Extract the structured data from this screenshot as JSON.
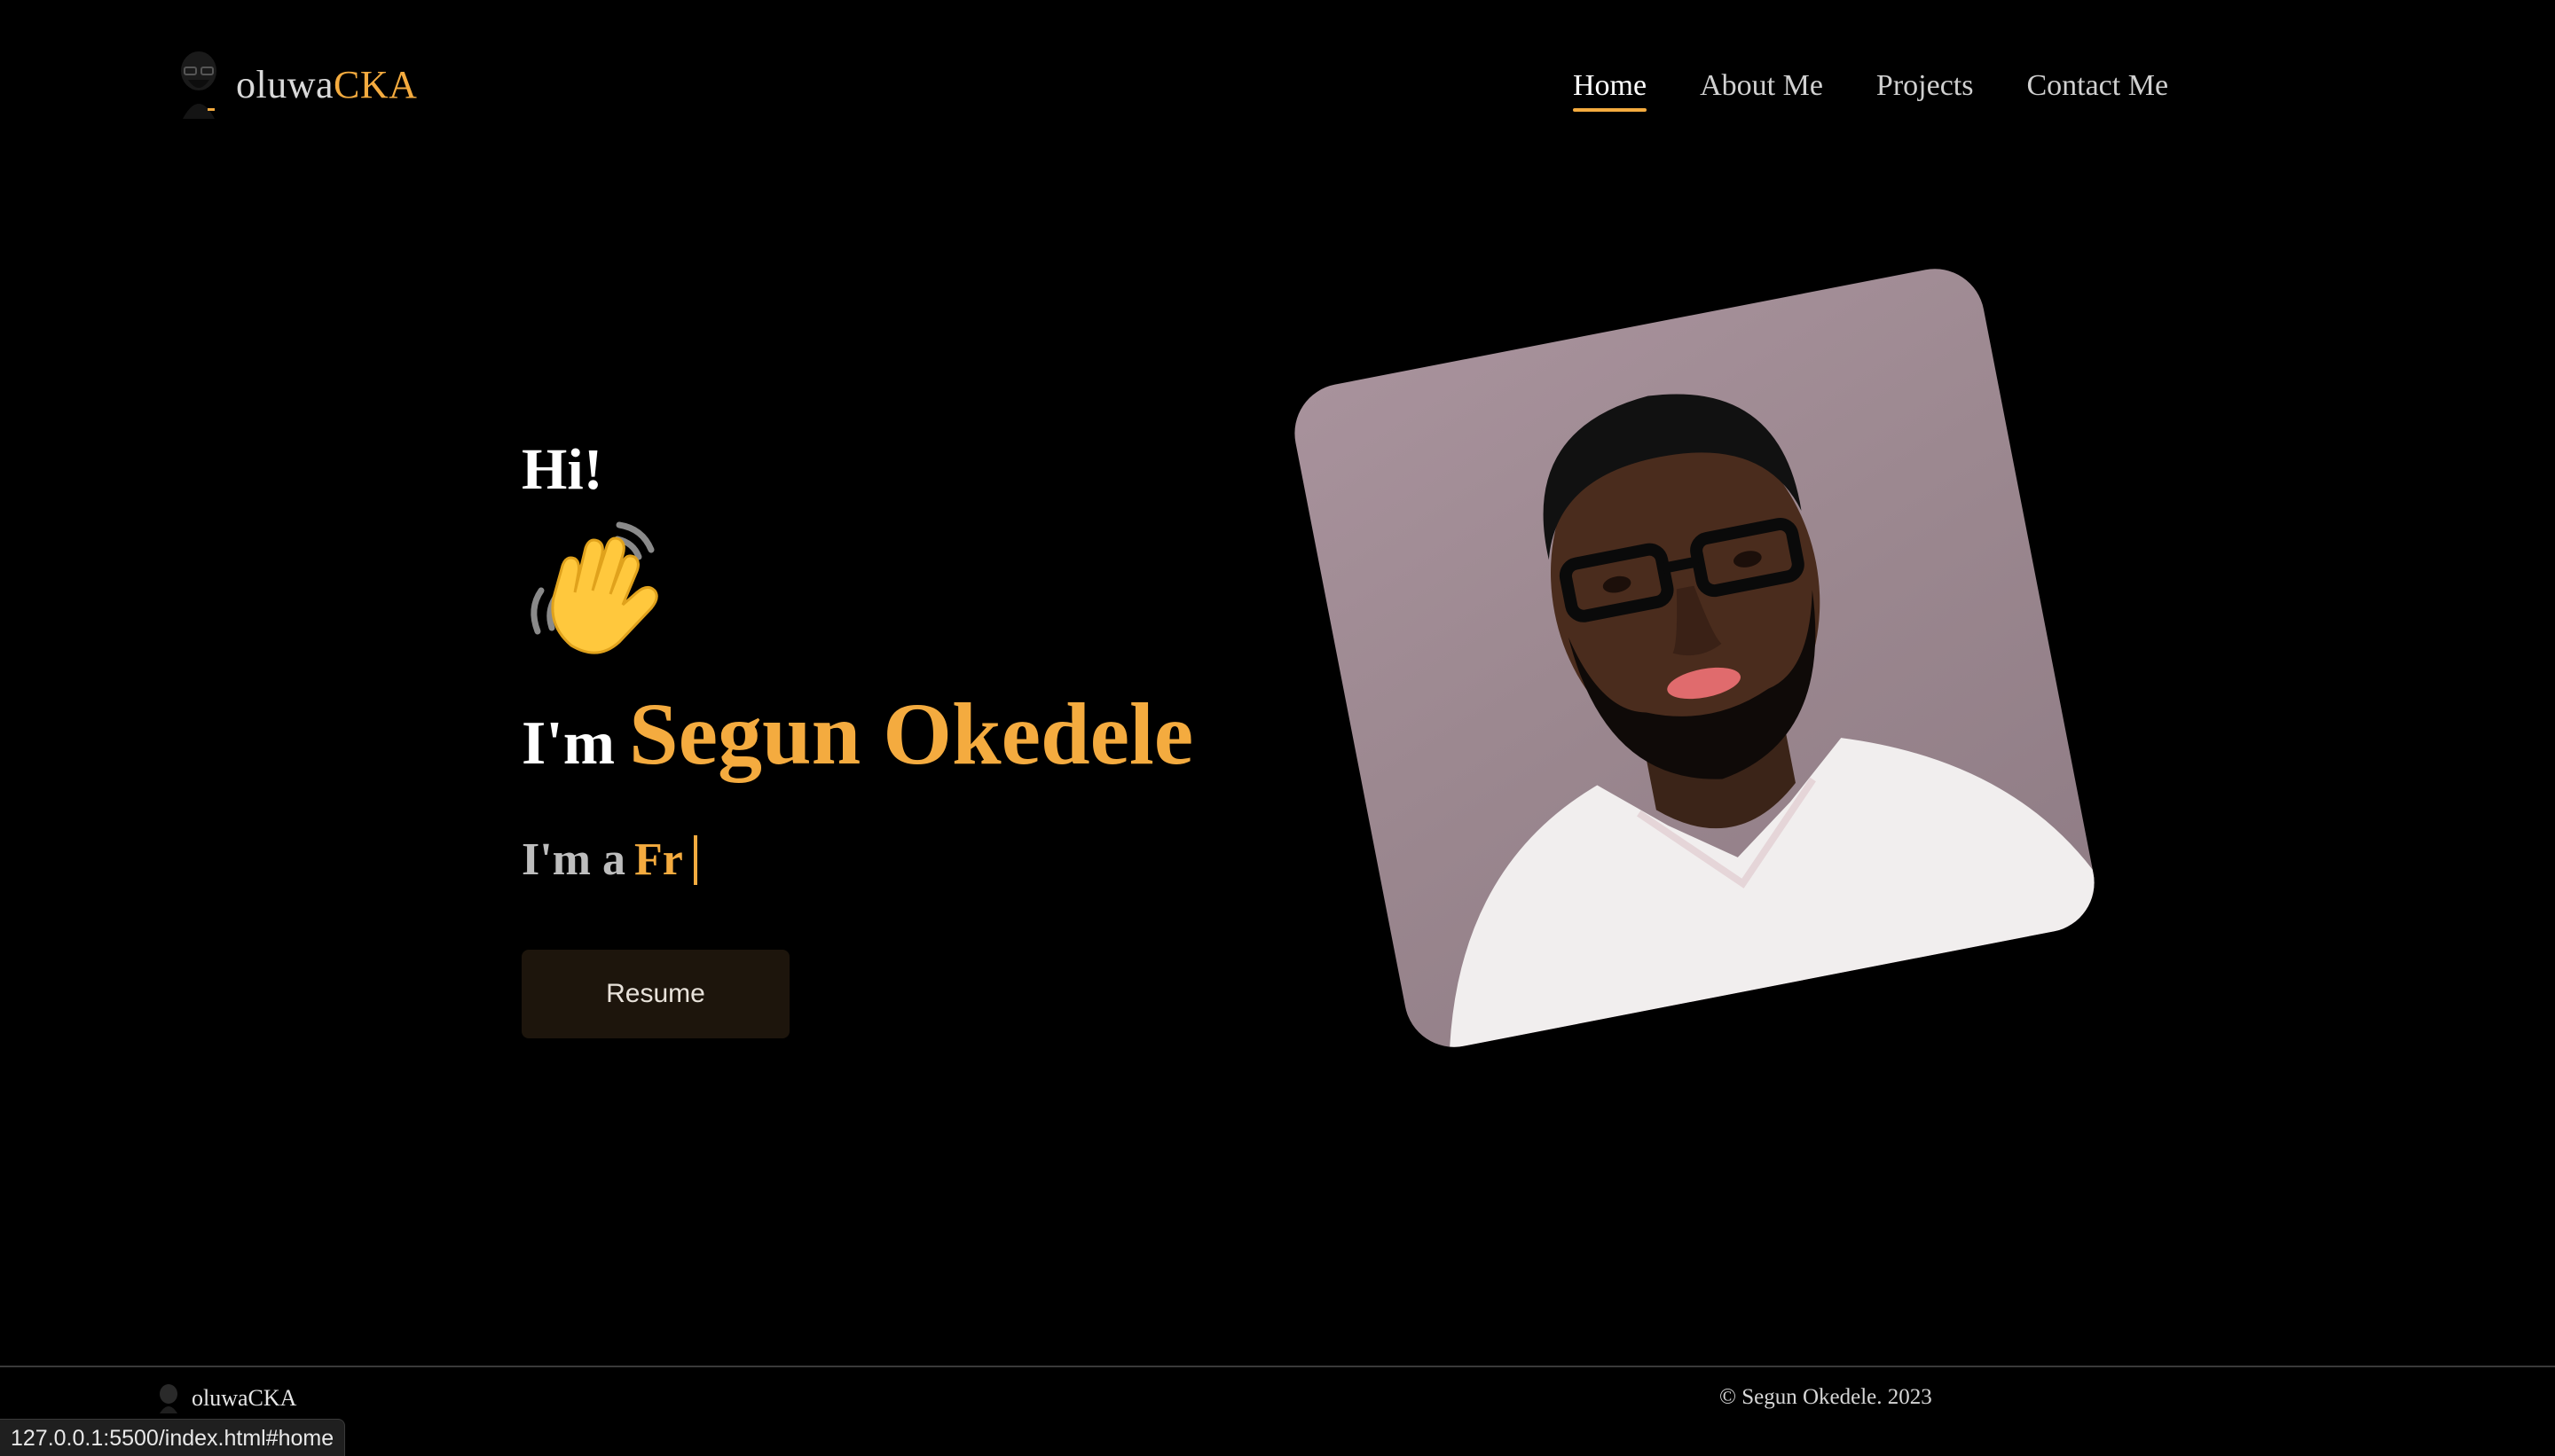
{
  "header": {
    "logo": {
      "prefix": "oluwa",
      "accent": "CKA",
      "icon": "avatar-logo-icon"
    },
    "nav": [
      {
        "label": "Home",
        "active": true
      },
      {
        "label": "About Me",
        "active": false
      },
      {
        "label": "Projects",
        "active": false
      },
      {
        "label": "Contact Me",
        "active": false
      }
    ]
  },
  "hero": {
    "greeting": "Hi!",
    "wave_icon": "waving-hand-icon",
    "intro_label": "I'm",
    "name": "Segun Okedele",
    "role_label": "I'm a",
    "role_typed": "Fr",
    "resume_label": "Resume",
    "portrait_icon": "profile-portrait"
  },
  "footer": {
    "logo_text": "oluwaCKA",
    "copyright": "© Segun Okedele. 2023"
  },
  "status_bar": {
    "url": "127.0.0.1:5500/index.html#home"
  },
  "colors": {
    "background": "#000000",
    "accent": "#f4ab3f",
    "text": "#ffffff",
    "button_bg": "#1d150c"
  }
}
